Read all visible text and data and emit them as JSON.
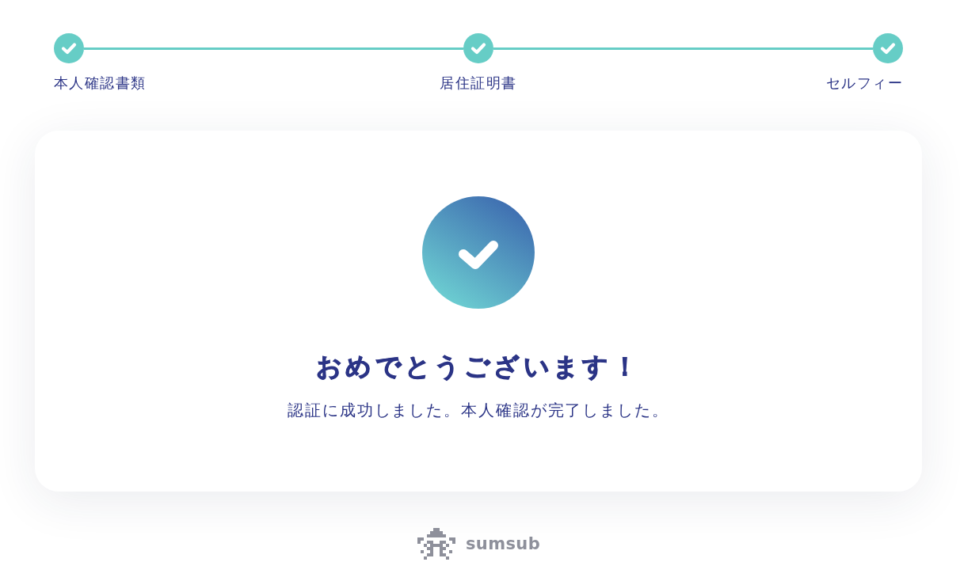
{
  "steps": [
    {
      "label": "本人確認書類",
      "done": true
    },
    {
      "label": "居住証明書",
      "done": true
    },
    {
      "label": "セルフィー",
      "done": true
    }
  ],
  "result": {
    "title": "おめでとうございます！",
    "message": "認証に成功しました。本人確認が完了しました。"
  },
  "footer": {
    "brand": "sumsub"
  }
}
